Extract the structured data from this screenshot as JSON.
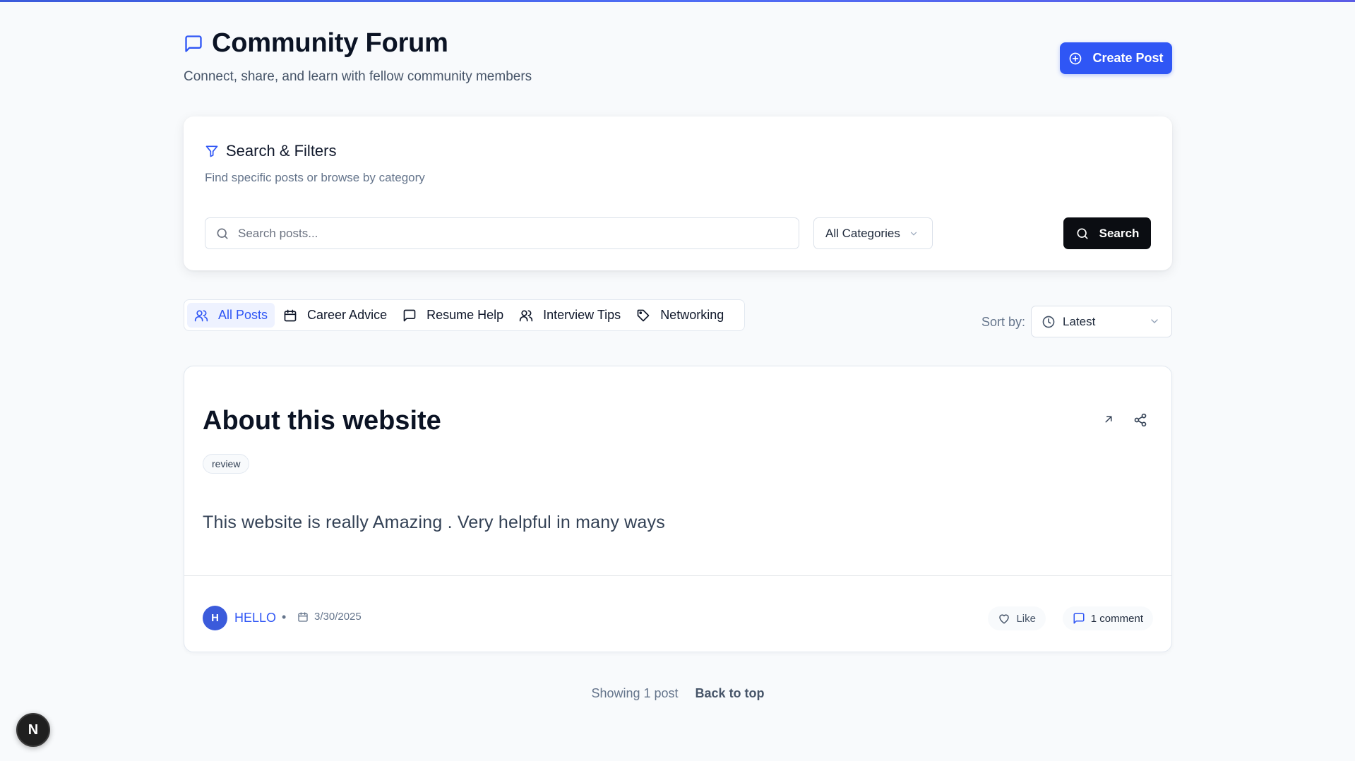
{
  "header": {
    "title": "Community Forum",
    "subtitle": "Connect, share, and learn with fellow community members",
    "create_label": "Create Post"
  },
  "filters": {
    "title": "Search & Filters",
    "description": "Find specific posts or browse by category",
    "search_placeholder": "Search posts...",
    "search_value": "",
    "category_selected": "All Categories",
    "search_button": "Search"
  },
  "tabs": [
    {
      "label": "All Posts",
      "icon": "users-icon",
      "active": true
    },
    {
      "label": "Career Advice",
      "icon": "calendar-icon",
      "active": false
    },
    {
      "label": "Resume Help",
      "icon": "message-icon",
      "active": false
    },
    {
      "label": "Interview Tips",
      "icon": "users-icon",
      "active": false
    },
    {
      "label": "Networking",
      "icon": "tag-icon",
      "active": false
    }
  ],
  "sort": {
    "label": "Sort by:",
    "selected": "Latest"
  },
  "post": {
    "title": "About this website",
    "tag": "review",
    "body": "This website is really Amazing . Very helpful in many ways",
    "author_initial": "H",
    "author": "HELLO",
    "separator": "•",
    "date": "3/30/2025",
    "like_label": "Like",
    "comment_label": "1 comment"
  },
  "footer": {
    "count_text": "Showing 1 post",
    "back_to_top": "Back to top"
  },
  "badge": {
    "letter": "N"
  },
  "colors": {
    "accent": "#2f56f5",
    "dark_button": "#0b0d12",
    "background": "#f8fafc"
  }
}
